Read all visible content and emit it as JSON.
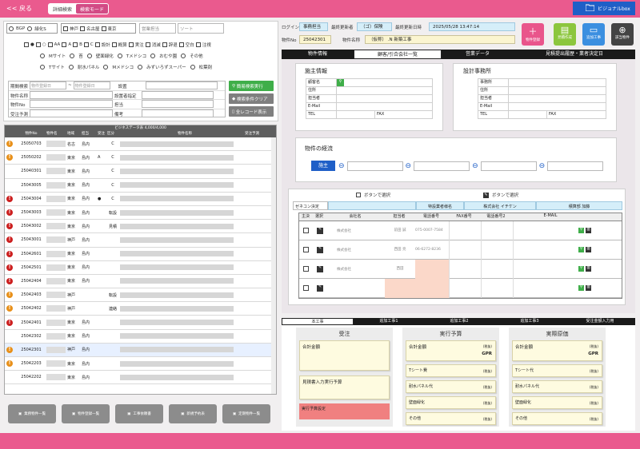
{
  "header": {
    "back": "<< 戻る",
    "modes": [
      "詳細検索",
      "検索モード"
    ],
    "box_label": "ビジョナルbox"
  },
  "search": {
    "radios": [
      "BGP",
      "緑化S"
    ],
    "areas": [
      "神戸",
      "名古屋",
      "東京"
    ],
    "sel1_placeholder": "営業担当",
    "sel2_placeholder": "ソート",
    "filter_checks": [
      "●",
      "○",
      "AA",
      "A",
      "B",
      "C",
      "設計",
      "概算",
      "実注",
      "消滅",
      "辞退",
      "空白",
      "注視"
    ],
    "types_row1": [
      "Mサイト",
      "苔",
      "壁面緑化",
      "Tメドシコ",
      "おむや園",
      "その他"
    ],
    "types_row2": [
      "Tサイト",
      "耐水パネル",
      "Mメドシコ",
      "みずいろずスーパー",
      "松葉剤"
    ],
    "fields_left": [
      "期間検索",
      "物件名称",
      "物件No",
      "受注予測"
    ],
    "date_placeholder": "物件登録日",
    "fields_right": [
      "設置",
      "設置者指定",
      "担当",
      "備考"
    ],
    "btn_search": "簡易検索実行",
    "btn_clear": "検索条件クリア",
    "btn_all": "全レコード表示"
  },
  "list": {
    "title": "ビジネスデータ表 4,000/4,000",
    "columns": [
      "",
      "物件No",
      "物件名",
      "地域",
      "担当",
      "受注",
      "区分",
      "",
      "物件名称",
      "受注予測"
    ],
    "rows": [
      {
        "no": "25050703",
        "area": "名古",
        "staff": "島内",
        "mark": "",
        "kind": "C",
        "warn": "o"
      },
      {
        "no": "25050202",
        "area": "東京",
        "staff": "島内",
        "mark": "A",
        "kind": "C",
        "warn": "o"
      },
      {
        "no": "25040301",
        "area": "東京",
        "staff": "島内",
        "mark": "",
        "kind": "C",
        "warn": ""
      },
      {
        "no": "25043005",
        "area": "東京",
        "staff": "島内",
        "mark": "",
        "kind": "C",
        "warn": ""
      },
      {
        "no": "25043004",
        "area": "東京",
        "staff": "島内",
        "mark": "●",
        "kind": "C",
        "warn": "r"
      },
      {
        "no": "25043003",
        "area": "東京",
        "staff": "島内",
        "mark": "",
        "kind": "転設",
        "warn": "r"
      },
      {
        "no": "25043002",
        "area": "東京",
        "staff": "島内",
        "mark": "",
        "kind": "見積",
        "warn": "r"
      },
      {
        "no": "25043001",
        "area": "神戸",
        "staff": "島内",
        "mark": "",
        "kind": "",
        "warn": "r"
      },
      {
        "no": "25042601",
        "area": "東京",
        "staff": "島内",
        "mark": "",
        "kind": "",
        "warn": "r"
      },
      {
        "no": "25042501",
        "area": "東京",
        "staff": "島内",
        "mark": "",
        "kind": "",
        "warn": "r"
      },
      {
        "no": "25042404",
        "area": "東京",
        "staff": "島内",
        "mark": "",
        "kind": "",
        "warn": "r"
      },
      {
        "no": "25042403",
        "area": "神戸",
        "staff": "",
        "mark": "",
        "kind": "転設",
        "warn": "o"
      },
      {
        "no": "25042402",
        "area": "神戸",
        "staff": "",
        "mark": "",
        "kind": "連絡",
        "warn": "o"
      },
      {
        "no": "25042401",
        "area": "東京",
        "staff": "島内",
        "mark": "",
        "kind": "",
        "warn": "r"
      },
      {
        "no": "25042302",
        "area": "東京",
        "staff": "島内",
        "mark": "",
        "kind": "",
        "warn": ""
      },
      {
        "no": "25042301",
        "area": "神戸",
        "staff": "島内",
        "mark": "",
        "kind": "",
        "warn": "o",
        "sel": true
      },
      {
        "no": "25042203",
        "area": "東京",
        "staff": "島内",
        "mark": "",
        "kind": "",
        "warn": "o"
      },
      {
        "no": "25042202",
        "area": "東京",
        "staff": "島内",
        "mark": "",
        "kind": "",
        "warn": ""
      }
    ]
  },
  "bottom_buttons": [
    "業務物件一覧",
    "物件登録一覧",
    "工事依頼書",
    "新規予約表",
    "定期物件一覧"
  ],
  "detail": {
    "login_label": "ログイン",
    "login_val": "事務担当",
    "updater_label": "最終更新者",
    "updater_val": "（ゴ）保険",
    "updated_label": "最終更新日時",
    "updated_val": "2025/05/28 13:47:14",
    "no_label": "物件No",
    "no_val": "25042301",
    "name_label": "物件名称",
    "name_val": "（仮称）  .N  新築工事",
    "actions": [
      "物件登録",
      "見積作成",
      "追加工事",
      "該当物件"
    ],
    "tabs": [
      "物件情報",
      "顧客/引合会社一覧",
      "営業データ",
      "見積提出履歴・業者決定日"
    ],
    "client_title": "施主情報",
    "client_fields": [
      "顧客名",
      "住所",
      "担当者",
      "E-Mail",
      "TEL"
    ],
    "fax": "FAX",
    "design_title": "設計事務所",
    "design_fields": [
      "事務所",
      "住所",
      "担当者",
      "E-Mail",
      "TEL"
    ],
    "route_title": "物件の経流",
    "route_btn": "施主",
    "select_left": "ボタンで選択",
    "select_right": "ボタンで選択",
    "gc_label": "ゼネコン決定",
    "gc_mid": "特設業者様名",
    "gc_val1": "株式会社 イチケン",
    "gc_val2": "積算部 加藤",
    "grid_cols": [
      "主決",
      "選択",
      "会社名",
      "担当者",
      "電話番号",
      "FAX番号",
      "電話番号2",
      "E-MAIL"
    ],
    "grid_rows": [
      {
        "company": "株式会社",
        "person": "前田 誠",
        "tel": "075-0007-7584"
      },
      {
        "company": "株式会社",
        "person": "西田 亮",
        "tel": "06-6272-8236"
      },
      {
        "company": "株式会社",
        "person": "西田",
        "tel": ""
      }
    ]
  },
  "work": {
    "tabs": [
      "本工事",
      "追加工事1",
      "追加工事2",
      "追加工事3",
      "受注金額入力用"
    ],
    "col1": {
      "title": "受注",
      "amount_label": "合計金額",
      "plan_label": "見積書入力実行予算",
      "budget_red": "実行予算設定"
    },
    "col2": {
      "title": "実行予算",
      "total_label": "合計金額",
      "tax": "(税抜)",
      "currency": "GPR",
      "items": [
        "Tシート費",
        "耐水パネル代",
        "壁面緑化",
        "その他"
      ]
    },
    "col3": {
      "title": "実際原価",
      "total_label": "合計金額",
      "tax": "(税抜)",
      "currency": "GPR",
      "items": [
        "Tシート代",
        "耐水パネル代",
        "壁面緑化",
        "その他"
      ]
    },
    "item_tax": "(税抜)"
  },
  "colors": {
    "brand": "#ea5a8e",
    "accent": "#d24b85",
    "blue": "#1f5fc7",
    "green": "#3fae49"
  }
}
